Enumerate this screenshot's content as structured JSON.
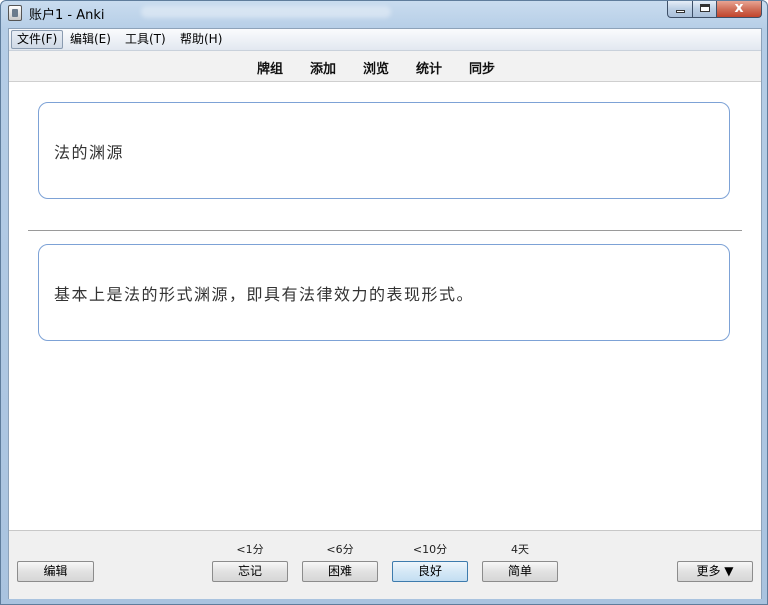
{
  "window": {
    "title": "账户1 - Anki",
    "close_glyph": "x"
  },
  "menubar": {
    "items": [
      "文件(F)",
      "编辑(E)",
      "工具(T)",
      "帮助(H)"
    ]
  },
  "toolbar": {
    "links": [
      "牌组",
      "添加",
      "浏览",
      "统计",
      "同步"
    ]
  },
  "card": {
    "front": "法的渊源",
    "back": "基本上是法的形式渊源，即具有法律效力的表现形式。"
  },
  "bottom": {
    "edit_label": "编辑",
    "answers": [
      {
        "interval": "<1分",
        "label": "忘记"
      },
      {
        "interval": "<6分",
        "label": "困难"
      },
      {
        "interval": "<10分",
        "label": "良好"
      },
      {
        "interval": "4天",
        "label": "简单"
      }
    ],
    "more_label": "更多 ▼"
  },
  "colors": {
    "card_border": "#7da2d6",
    "default_button": "#c3def2",
    "close_button": "#c2442c"
  },
  "icons": [
    "anki-app-icon",
    "minimize-icon",
    "maximize-icon",
    "close-icon"
  ]
}
